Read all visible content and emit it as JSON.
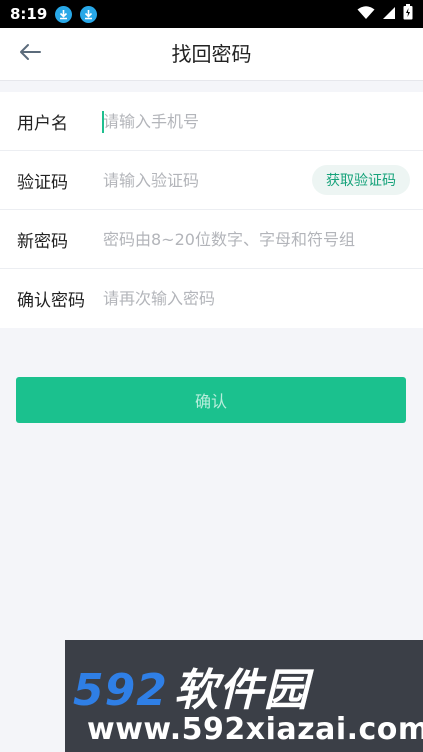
{
  "status_bar": {
    "time": "8:19",
    "icons": [
      "download-icon",
      "download-icon",
      "wifi-icon",
      "signal-icon",
      "battery-icon"
    ]
  },
  "app_bar": {
    "back_icon": "arrow-left-icon",
    "title": "找回密码"
  },
  "form": {
    "rows": [
      {
        "label": "用户名",
        "placeholder": "请输入手机号",
        "value": ""
      },
      {
        "label": "验证码",
        "placeholder": "请输入验证码",
        "value": "",
        "action": "获取验证码"
      },
      {
        "label": "新密码",
        "placeholder": "密码由8~20位数字、字母和符号组",
        "value": ""
      },
      {
        "label": "确认密码",
        "placeholder": "请再次输入密码",
        "value": ""
      }
    ]
  },
  "confirm_button": {
    "label": "确认"
  },
  "watermark": {
    "logo_number": "592",
    "logo_text": "软件园",
    "url": "www.592xiazai.com"
  },
  "colors": {
    "accent": "#1bc18e",
    "accent_text": "#17a37b",
    "background": "#f4f5f9"
  }
}
